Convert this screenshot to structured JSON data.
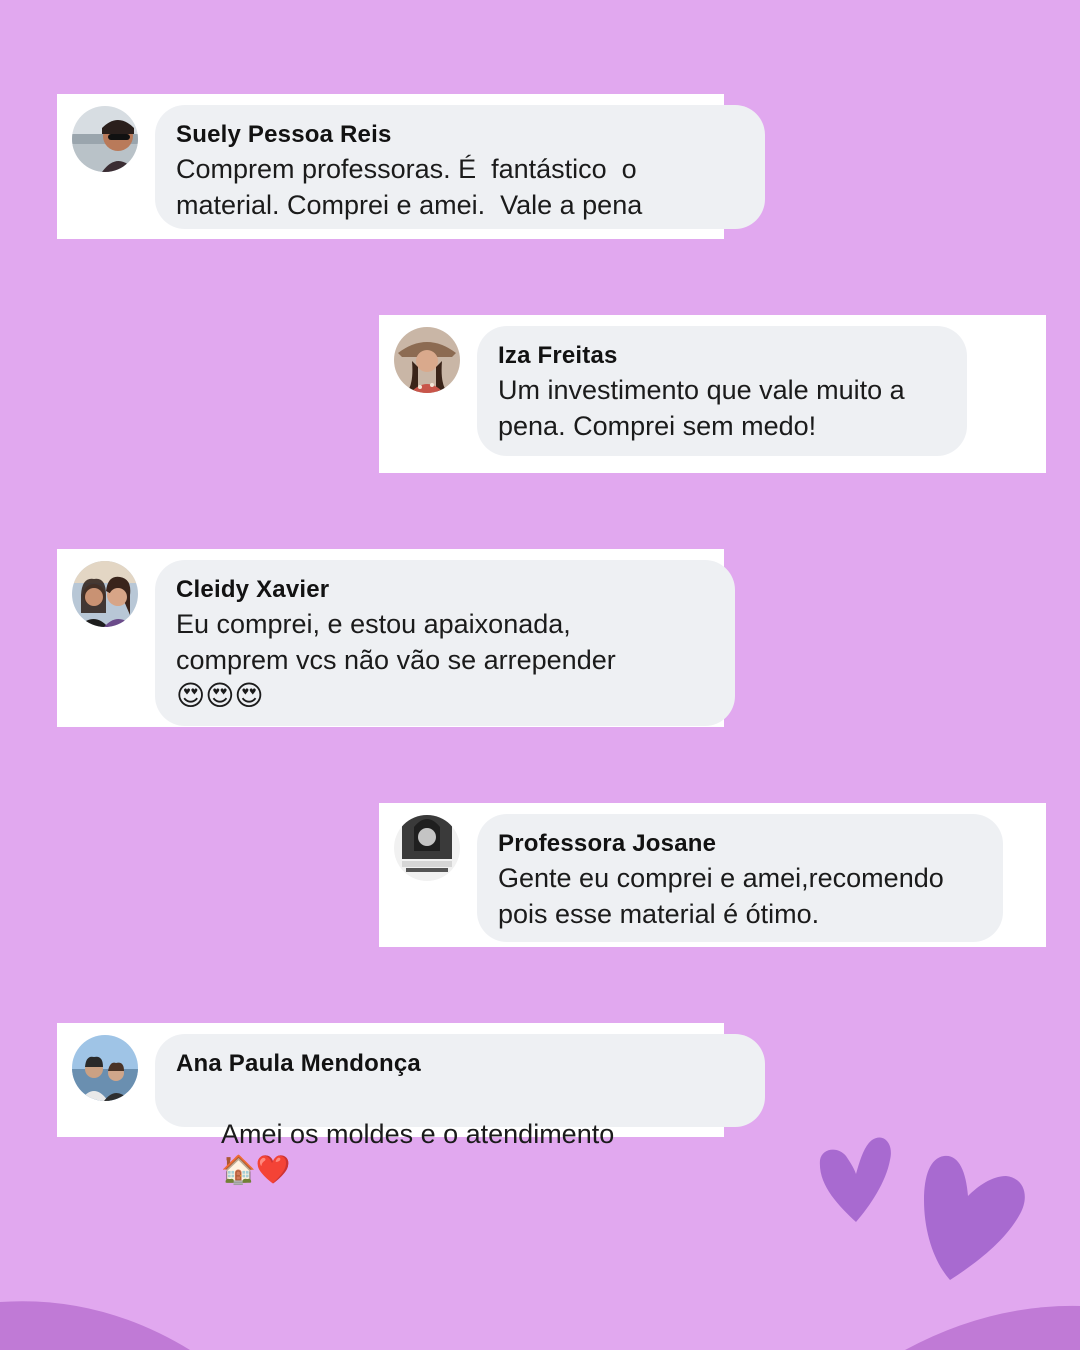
{
  "comments": [
    {
      "name": "Suely Pessoa Reis",
      "text": "Comprem professoras. É  fantástico  o\nmaterial. Comprei e amei.  Vale a pena",
      "emoji": ""
    },
    {
      "name": "Iza Freitas",
      "text": "Um investimento que vale muito a\npena. Comprei sem medo!",
      "emoji": ""
    },
    {
      "name": "Cleidy Xavier",
      "text": "Eu comprei, e estou apaixonada,\ncomprem vcs não vão se arrepender",
      "emoji": "😍😍😍"
    },
    {
      "name": "Professora Josane",
      "text": "Gente eu comprei e amei,recomendo\npois esse material é ótimo.",
      "emoji": ""
    },
    {
      "name": "Ana Paula Mendonça",
      "text": "Amei os moldes e o atendimento",
      "emoji": "🏠❤️"
    }
  ],
  "colors": {
    "background": "#e1a8ef",
    "card": "#ffffff",
    "bubble": "#eef0f3",
    "heart": "#a86ad0",
    "wave": "#c07ad6"
  },
  "icons": [
    "heart-icon",
    "heart-icon"
  ]
}
